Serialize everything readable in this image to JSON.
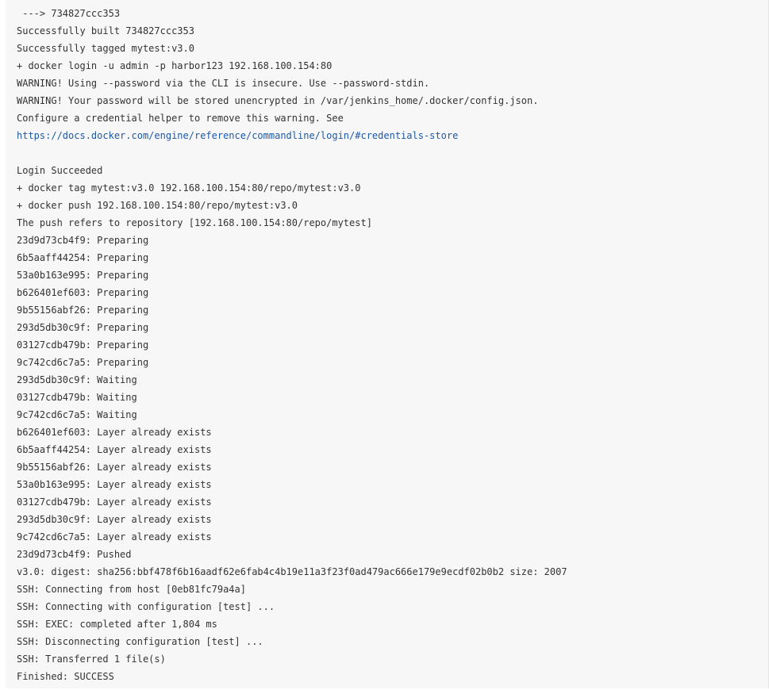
{
  "console": {
    "lines": [
      " ---> 734827ccc353",
      "Successfully built 734827ccc353",
      "Successfully tagged mytest:v3.0",
      "+ docker login -u admin -p harbor123 192.168.100.154:80",
      "WARNING! Using --password via the CLI is insecure. Use --password-stdin.",
      "WARNING! Your password will be stored unencrypted in /var/jenkins_home/.docker/config.json.",
      "Configure a credential helper to remove this warning. See",
      "https://docs.docker.com/engine/reference/commandline/login/#credentials-store",
      "",
      "Login Succeeded",
      "+ docker tag mytest:v3.0 192.168.100.154:80/repo/mytest:v3.0",
      "+ docker push 192.168.100.154:80/repo/mytest:v3.0",
      "The push refers to repository [192.168.100.154:80/repo/mytest]",
      "23d9d73cb4f9: Preparing",
      "6b5aaff44254: Preparing",
      "53a0b163e995: Preparing",
      "b626401ef603: Preparing",
      "9b55156abf26: Preparing",
      "293d5db30c9f: Preparing",
      "03127cdb479b: Preparing",
      "9c742cd6c7a5: Preparing",
      "293d5db30c9f: Waiting",
      "03127cdb479b: Waiting",
      "9c742cd6c7a5: Waiting",
      "b626401ef603: Layer already exists",
      "6b5aaff44254: Layer already exists",
      "9b55156abf26: Layer already exists",
      "53a0b163e995: Layer already exists",
      "03127cdb479b: Layer already exists",
      "293d5db30c9f: Layer already exists",
      "9c742cd6c7a5: Layer already exists",
      "23d9d73cb4f9: Pushed",
      "v3.0: digest: sha256:bbf478f6b16aadf62e6fab4c4b19e11a3f23f0ad479ac666e179e9ecdf02b0b2 size: 2007",
      "SSH: Connecting from host [0eb81fc79a4a]",
      "SSH: Connecting with configuration [test] ...",
      "SSH: EXEC: completed after 1,804 ms",
      "SSH: Disconnecting configuration [test] ...",
      "SSH: Transferred 1 file(s)",
      "Finished: SUCCESS"
    ],
    "link_line_index": 7,
    "link_color": "#1d59a5",
    "text_color": "#333333",
    "background_color": "#f7f7f7"
  }
}
